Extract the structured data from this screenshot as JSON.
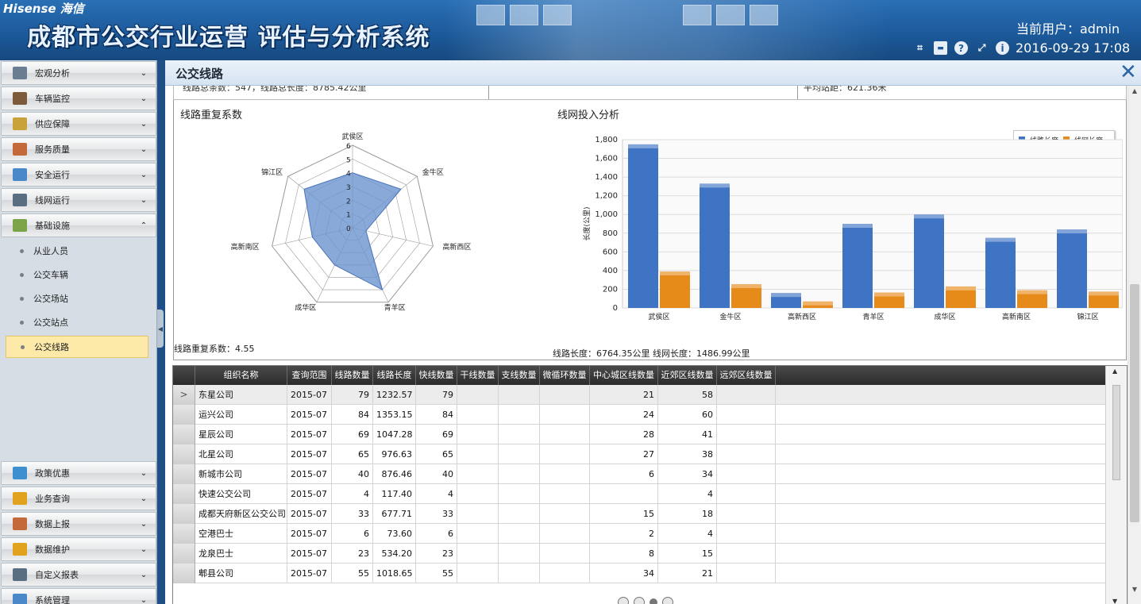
{
  "header": {
    "brand": "Hisense 海信",
    "system_title": "成都市公交行业运营 评估与分析系统",
    "current_user": "当前用户：admin",
    "datetime": "2016-09-29 17:08",
    "icons": [
      "crop-icon",
      "window-icon",
      "help-icon",
      "fullscreen-icon",
      "info-icon"
    ]
  },
  "sidebar": {
    "top_items": [
      {
        "label": "宏观分析",
        "icon_color": "#6b7d90"
      },
      {
        "label": "车辆监控",
        "icon_color": "#7d5b3a"
      },
      {
        "label": "供应保障",
        "icon_color": "#c9a23a"
      },
      {
        "label": "服务质量",
        "icon_color": "#c46a3a"
      },
      {
        "label": "安全运行",
        "icon_color": "#4a88c7"
      },
      {
        "label": "线网运行",
        "icon_color": "#5a6e82"
      },
      {
        "label": "基础设施",
        "icon_color": "#7aa447"
      }
    ],
    "sub_items": [
      "从业人员",
      "公交车辆",
      "公交场站",
      "公交站点",
      "公交线路"
    ],
    "bottom_items": [
      {
        "label": "政策优惠",
        "icon_color": "#3d8fd0"
      },
      {
        "label": "业务查询",
        "icon_color": "#e1a21d"
      },
      {
        "label": "数据上报",
        "icon_color": "#c46a3a"
      },
      {
        "label": "数据维护",
        "icon_color": "#e1a21d"
      },
      {
        "label": "自定义报表",
        "icon_color": "#5a6e82"
      },
      {
        "label": "系统管理",
        "icon_color": "#4a88c7"
      }
    ]
  },
  "panel": {
    "title": "公交线路",
    "summary_left": "线路总条数：547，线路总长度：8785.42公里",
    "summary_right": "平均站距：621.36米"
  },
  "radar": {
    "title": "线路重复系数",
    "footer": "线路重复系数：4.55",
    "axes": [
      "武侯区",
      "金牛区",
      "高新西区",
      "青羊区",
      "成华区",
      "高新南区",
      "锦江区"
    ],
    "values": [
      4.0,
      4.5,
      1.0,
      5.0,
      3.0,
      3.0,
      4.5
    ],
    "ticks": [
      "0",
      "1",
      "2",
      "3",
      "4",
      "5",
      "6"
    ],
    "max": 6,
    "fill_color": "#6b93cf"
  },
  "chart_data": {
    "type": "bar",
    "title": "线网投入分析",
    "ylabel": "长度(公里)",
    "categories": [
      "武侯区",
      "金牛区",
      "高新西区",
      "青羊区",
      "成华区",
      "高新南区",
      "锦江区"
    ],
    "series": [
      {
        "name": "线路长度",
        "color": "#3f73c4",
        "values": [
          1750,
          1330,
          160,
          900,
          1000,
          750,
          840
        ]
      },
      {
        "name": "线网长度",
        "color": "#e68a1a",
        "values": [
          390,
          255,
          70,
          165,
          230,
          190,
          175
        ]
      }
    ],
    "yticks": [
      "0",
      "200",
      "400",
      "600",
      "800",
      "1,000",
      "1,200",
      "1,400",
      "1,600",
      "1,800"
    ],
    "ylim": [
      0,
      1800
    ],
    "legend": "top-right",
    "footer": "线路长度：6764.35公里 线网长度：1486.99公里"
  },
  "grid": {
    "columns": [
      "组织名称",
      "查询范围",
      "线路数量",
      "线路长度",
      "快线数量",
      "干线数量",
      "支线数量",
      "微循环数量",
      "中心城区线数量",
      "近郊区线数量",
      "远郊区线数量"
    ],
    "rows": [
      [
        "东星公司",
        "2015-07",
        "79",
        "1232.57",
        "79",
        "",
        "",
        "",
        "21",
        "58",
        ""
      ],
      [
        "运兴公司",
        "2015-07",
        "84",
        "1353.15",
        "84",
        "",
        "",
        "",
        "24",
        "60",
        ""
      ],
      [
        "星辰公司",
        "2015-07",
        "69",
        "1047.28",
        "69",
        "",
        "",
        "",
        "28",
        "41",
        ""
      ],
      [
        "北星公司",
        "2015-07",
        "65",
        "976.63",
        "65",
        "",
        "",
        "",
        "27",
        "38",
        ""
      ],
      [
        "新城市公司",
        "2015-07",
        "40",
        "876.46",
        "40",
        "",
        "",
        "",
        "6",
        "34",
        ""
      ],
      [
        "快速公交公司",
        "2015-07",
        "4",
        "117.40",
        "4",
        "",
        "",
        "",
        "",
        "4",
        ""
      ],
      [
        "成都天府新区公交公司",
        "2015-07",
        "33",
        "677.71",
        "33",
        "",
        "",
        "",
        "15",
        "18",
        ""
      ],
      [
        "空港巴士",
        "2015-07",
        "6",
        "73.60",
        "6",
        "",
        "",
        "",
        "2",
        "4",
        ""
      ],
      [
        "龙泉巴士",
        "2015-07",
        "23",
        "534.20",
        "23",
        "",
        "",
        "",
        "8",
        "15",
        ""
      ],
      [
        "郫县公司",
        "2015-07",
        "55",
        "1018.65",
        "55",
        "",
        "",
        "",
        "34",
        "21",
        ""
      ]
    ],
    "selected_marker": ">"
  }
}
